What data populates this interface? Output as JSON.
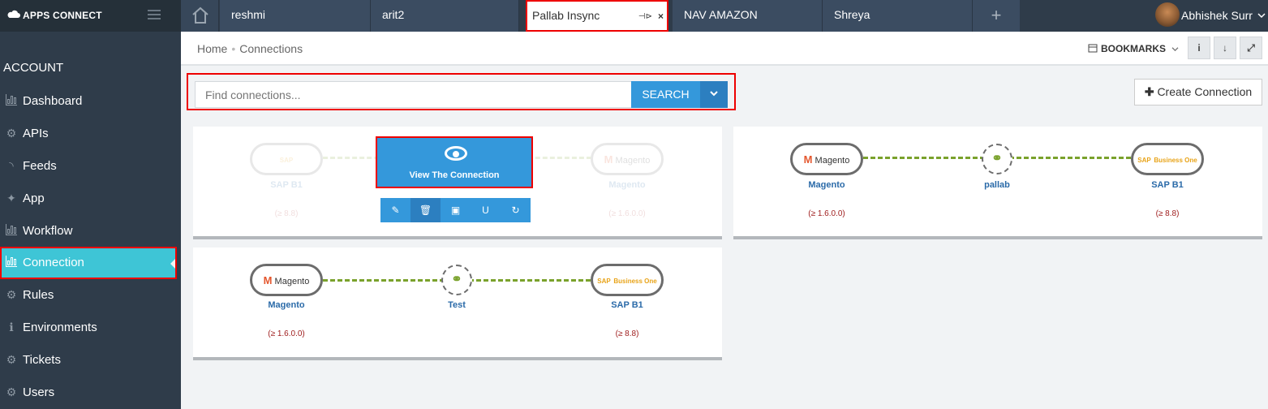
{
  "brand": {
    "name": "APPS CONNECT"
  },
  "tabs": [
    {
      "label": "reshmi"
    },
    {
      "label": "arit2"
    },
    {
      "label": "Pallab Insync",
      "pin": "⊣⊳",
      "close": "×"
    },
    {
      "label": "NAV AMAZON"
    },
    {
      "label": "Shreya"
    }
  ],
  "add_tab": "+",
  "user": {
    "name": "Abhishek Surr"
  },
  "sidebar": {
    "heading": "ACCOUNT",
    "items": [
      {
        "label": "Dashboard",
        "icon": "bar-chart-icon"
      },
      {
        "label": "APIs",
        "icon": "gear-icon"
      },
      {
        "label": "Feeds",
        "icon": "rss-icon"
      },
      {
        "label": "App",
        "icon": "puzzle-icon"
      },
      {
        "label": "Workflow",
        "icon": "bar-chart-icon"
      },
      {
        "label": "Connection",
        "icon": "bar-chart-icon",
        "active": true
      },
      {
        "label": "Rules",
        "icon": "gear-icon"
      },
      {
        "label": "Environments",
        "icon": "info-icon"
      },
      {
        "label": "Tickets",
        "icon": "gear-icon"
      },
      {
        "label": "Users",
        "icon": "gear-icon"
      }
    ]
  },
  "breadcrumb": {
    "home": "Home",
    "sep": "•",
    "current": "Connections"
  },
  "toolbar": {
    "bookmarks": "BOOKMARKS",
    "info": "i",
    "download": "↓",
    "expand": "⤢"
  },
  "search": {
    "placeholder": "Find connections...",
    "button": "SEARCH"
  },
  "create_button": "Create Connection",
  "connections": [
    {
      "left": {
        "name": "SAP B1",
        "version": "(≥ 8.8)"
      },
      "link": "",
      "right": {
        "name": "Magento",
        "version": "(≥ 1.6.0.0)"
      },
      "overlay": "View The Connection"
    },
    {
      "left": {
        "name": "Magento",
        "version": "(≥ 1.6.0.0)"
      },
      "link": "pallab",
      "right": {
        "name": "SAP B1",
        "version": "(≥ 8.8)"
      }
    },
    {
      "left": {
        "name": "Magento",
        "version": "(≥ 1.6.0.0)"
      },
      "link": "Test",
      "right": {
        "name": "SAP B1",
        "version": "(≥ 8.8)"
      }
    }
  ],
  "logo_text": {
    "magento": "Magento",
    "sap": "SAP",
    "sap_sub": "Business One"
  },
  "colors": {
    "accent": "#3498db",
    "sidebar": "#2f3c4a",
    "active": "#3ec5d6",
    "link": "#7aa22c"
  }
}
